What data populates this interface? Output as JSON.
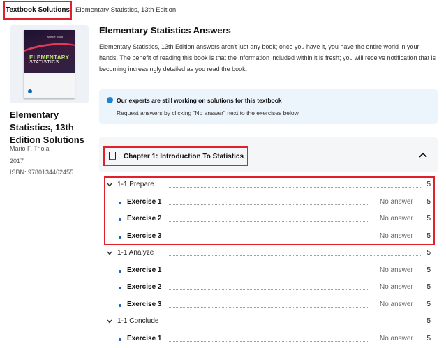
{
  "breadcrumb": {
    "active": "Textbook Solutions",
    "current": "Elementary Statistics, 13th Edition"
  },
  "sidebar": {
    "cover": {
      "author": "Mario F. Triola",
      "title_line1": "ELEMENTARY",
      "title_line2": "STATISTICS"
    },
    "title": "Elementary Statistics, 13th Edition Solutions",
    "author": "Mario F. Triola",
    "year": "2017",
    "isbn": "ISBN: 9780134462455"
  },
  "main": {
    "title": "Elementary Statistics Answers",
    "intro": "Elementary Statistics, 13th Edition answers aren't just any book; once you have it, you have the entire world in your hands. The benefit of reading this book is that the information included within it is fresh; you will receive notification that is becoming increasingly detailed as you read the book.",
    "notice": {
      "icon": "info-icon",
      "title": "Our experts are still working on solutions for this textbook",
      "subtitle": "Request answers by clicking “No answer” next to the exercises below."
    },
    "chapter": {
      "icon": "book-icon",
      "title": "Chapter 1: Introduction To Statistics",
      "toggle_icon": "chevron-up-icon"
    },
    "sections": [
      {
        "label": "1-1 Prepare",
        "count": "5",
        "exercises": [
          {
            "label": "Exercise 1",
            "status": "No answer",
            "count": "5"
          },
          {
            "label": "Exercise 2",
            "status": "No answer",
            "count": "5"
          },
          {
            "label": "Exercise 3",
            "status": "No answer",
            "count": "5"
          }
        ]
      },
      {
        "label": "1-1 Analyze",
        "count": "5",
        "exercises": [
          {
            "label": "Exercise 1",
            "status": "No answer",
            "count": "5"
          },
          {
            "label": "Exercise 2",
            "status": "No answer",
            "count": "5"
          },
          {
            "label": "Exercise 3",
            "status": "No answer",
            "count": "5"
          }
        ]
      },
      {
        "label": "1-1 Conclude",
        "count": "5",
        "exercises": [
          {
            "label": "Exercise 1",
            "status": "No answer",
            "count": "5"
          }
        ]
      }
    ]
  },
  "colors": {
    "highlight": "#e0202a",
    "accent": "#1a82d1",
    "notice_bg": "#edf5fc",
    "card_bg": "#f4f6f8"
  }
}
